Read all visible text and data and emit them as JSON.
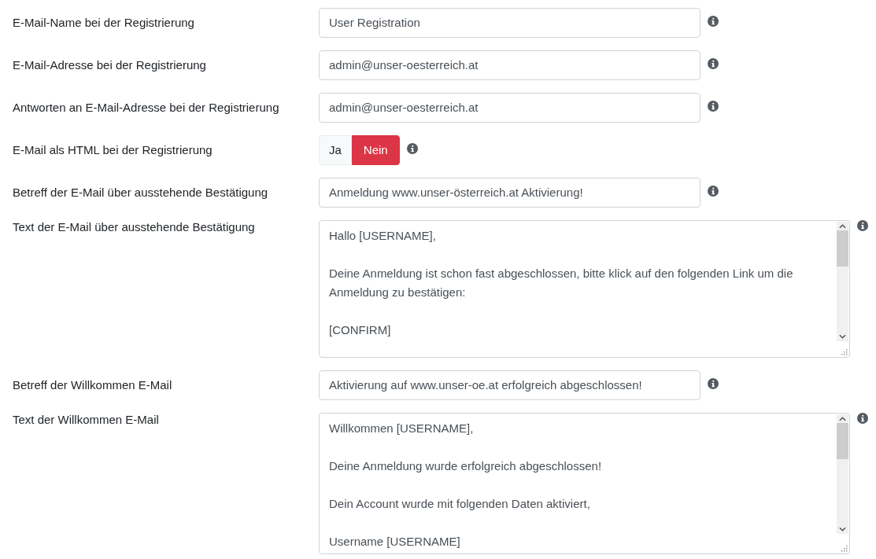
{
  "fields": [
    {
      "kind": "text",
      "label": "E-Mail-Name bei der Registrierung",
      "value": "User Registration"
    },
    {
      "kind": "text",
      "label": "E-Mail-Adresse bei der Registrierung",
      "value": "admin@unser-oesterreich.at"
    },
    {
      "kind": "text",
      "label": "Antworten an E-Mail-Adresse bei der Registrierung",
      "value": "admin@unser-oesterreich.at"
    },
    {
      "kind": "toggle",
      "label": "E-Mail als HTML bei der Registrierung",
      "options": [
        {
          "label": "Ja",
          "selected": false
        },
        {
          "label": "Nein",
          "selected": true
        }
      ]
    },
    {
      "kind": "text",
      "label": "Betreff der E-Mail über ausstehende Bestätigung",
      "value": "Anmeldung www.unser-österreich.at Aktivierung!"
    },
    {
      "kind": "textarea",
      "label": "Text der E-Mail über ausstehende Bestätigung",
      "value": "Hallo [USERNAME],\n\nDeine Anmeldung ist schon fast abgeschlossen, bitte klick auf den folgenden Link um die Anmeldung zu bestätigen:\n\n[CONFIRM]"
    },
    {
      "kind": "text",
      "label": "Betreff der Willkommen E-Mail",
      "value": "Aktivierung auf www.unser-oe.at erfolgreich abgeschlossen!"
    },
    {
      "kind": "textarea",
      "label": "Text der Willkommen E-Mail",
      "value": "Willkommen [USERNAME],\n\nDeine Anmeldung wurde erfolgreich abgeschlossen!\n\nDein Account wurde mit folgenden Daten aktiviert,\n\nUsername [USERNAME]"
    }
  ]
}
